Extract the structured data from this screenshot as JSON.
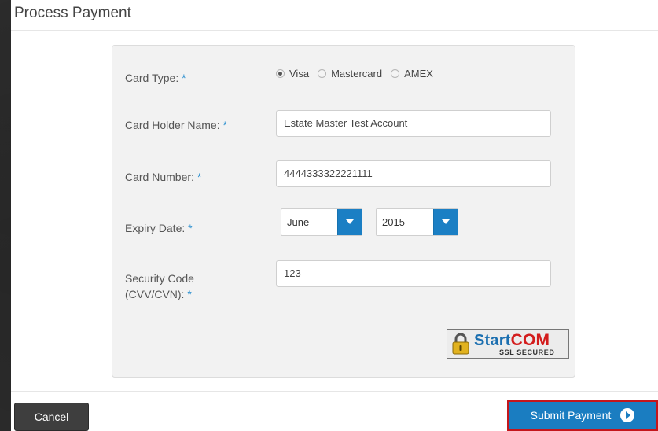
{
  "dialog": {
    "title": "Process Payment"
  },
  "form": {
    "required_marker": "*",
    "card_type": {
      "label": "Card Type:",
      "options": [
        "Visa",
        "Mastercard",
        "AMEX"
      ],
      "selected": "Visa"
    },
    "card_holder": {
      "label": "Card Holder Name:",
      "value": "Estate Master Test Account"
    },
    "card_number": {
      "label": "Card Number:",
      "value": "4444333322221111"
    },
    "expiry": {
      "label": "Expiry Date:",
      "month": "June",
      "year": "2015"
    },
    "security_code": {
      "label_line1": "Security Code",
      "label_line2": "(CVV/CVN):",
      "value": "123"
    },
    "ssl_badge": {
      "start": "Start",
      "com": "COM",
      "sub": "SSL SECURED",
      "icon": "padlock-icon"
    }
  },
  "footer": {
    "cancel_label": "Cancel",
    "submit_label": "Submit Payment",
    "submit_icon": "arrow-right-circle-icon"
  },
  "colors": {
    "accent": "#1a7dc1",
    "required": "#2a8fcf",
    "highlight_border": "#c4161c",
    "cancel_bg": "#3e3e3e"
  }
}
